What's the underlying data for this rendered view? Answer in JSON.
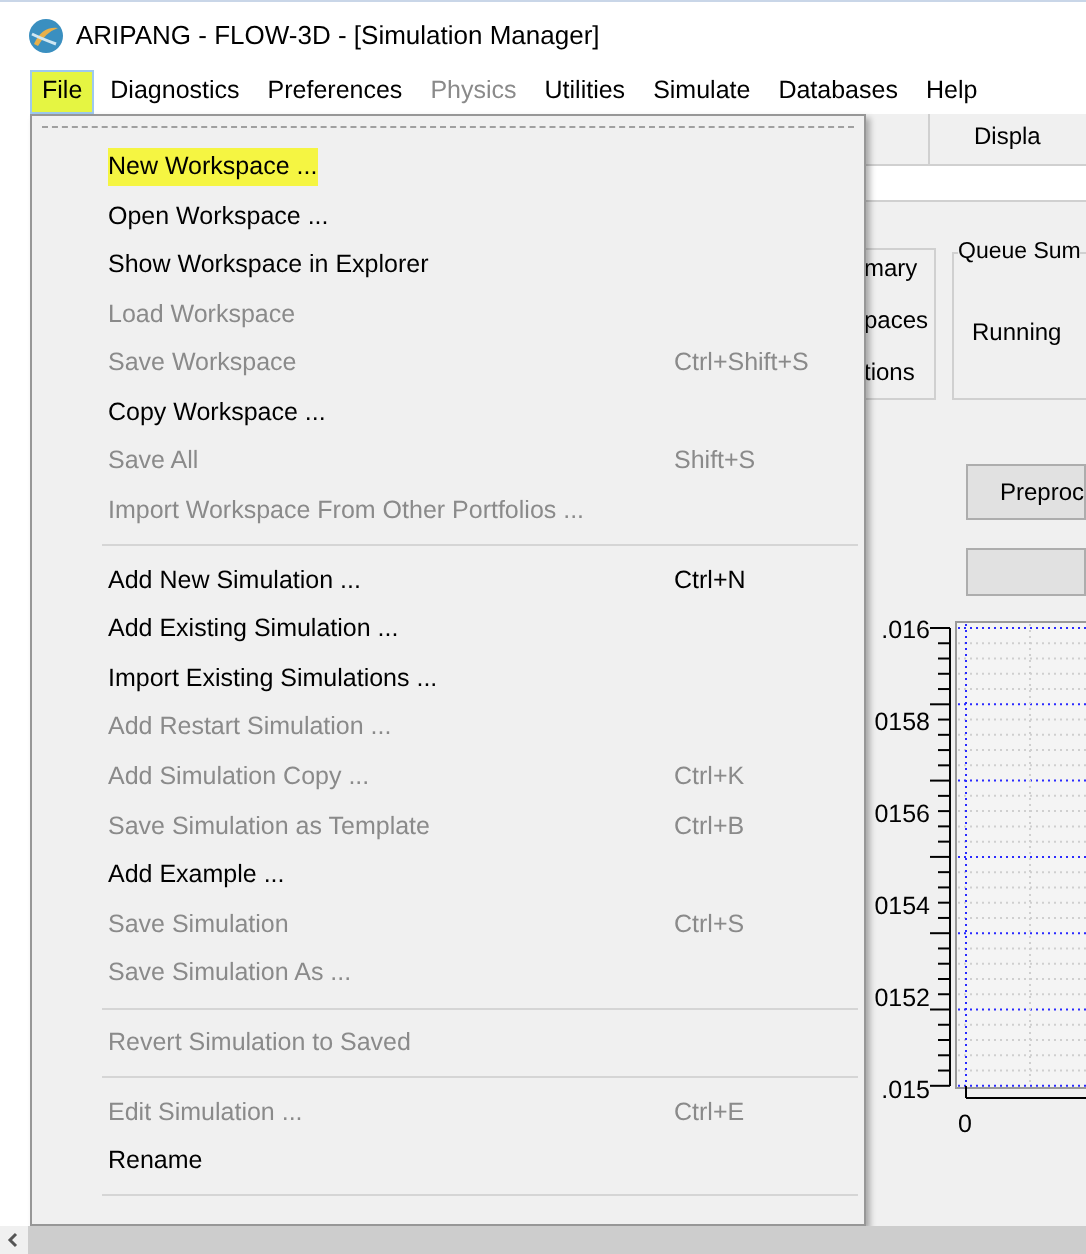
{
  "window": {
    "title": "ARIPANG - FLOW-3D - [Simulation Manager]"
  },
  "menu_bar": [
    {
      "label": "File",
      "selected": true,
      "disabled": false
    },
    {
      "label": "Diagnostics",
      "selected": false,
      "disabled": false
    },
    {
      "label": "Preferences",
      "selected": false,
      "disabled": false
    },
    {
      "label": "Physics",
      "selected": false,
      "disabled": true
    },
    {
      "label": "Utilities",
      "selected": false,
      "disabled": false
    },
    {
      "label": "Simulate",
      "selected": false,
      "disabled": false
    },
    {
      "label": "Databases",
      "selected": false,
      "disabled": false
    },
    {
      "label": "Help",
      "selected": false,
      "disabled": false
    }
  ],
  "file_menu": [
    {
      "kind": "item",
      "label": "New Workspace ...",
      "disabled": false,
      "selected": true
    },
    {
      "kind": "item",
      "label": "Open Workspace ...",
      "disabled": false,
      "selected": false
    },
    {
      "kind": "item",
      "label": "Show Workspace in Explorer",
      "disabled": false,
      "selected": false
    },
    {
      "kind": "item",
      "label": "Load Workspace",
      "disabled": true,
      "selected": false
    },
    {
      "kind": "item",
      "label": "Save Workspace",
      "shortcut": "Ctrl+Shift+S",
      "disabled": true,
      "selected": false
    },
    {
      "kind": "item",
      "label": "Copy Workspace ...",
      "disabled": false,
      "selected": false
    },
    {
      "kind": "item",
      "label": "Save All",
      "shortcut": "Shift+S",
      "disabled": true,
      "selected": false
    },
    {
      "kind": "item",
      "label": "Import Workspace From Other Portfolios ...",
      "disabled": true,
      "selected": false
    },
    {
      "kind": "separator"
    },
    {
      "kind": "item",
      "label": "Add New Simulation ...",
      "shortcut": "Ctrl+N",
      "disabled": false,
      "selected": false
    },
    {
      "kind": "item",
      "label": "Add Existing Simulation ...",
      "disabled": false,
      "selected": false
    },
    {
      "kind": "item",
      "label": "Import Existing Simulations ...",
      "disabled": false,
      "selected": false
    },
    {
      "kind": "item",
      "label": "Add Restart Simulation ...",
      "disabled": true,
      "selected": false
    },
    {
      "kind": "item",
      "label": "Add Simulation Copy ...",
      "shortcut": "Ctrl+K",
      "disabled": true,
      "selected": false
    },
    {
      "kind": "item",
      "label": "Save Simulation as Template",
      "shortcut": "Ctrl+B",
      "disabled": true,
      "selected": false
    },
    {
      "kind": "item",
      "label": "Add Example ...",
      "disabled": false,
      "selected": false
    },
    {
      "kind": "item",
      "label": "Save Simulation",
      "shortcut": "Ctrl+S",
      "disabled": true,
      "selected": false
    },
    {
      "kind": "item",
      "label": "Save Simulation As ...",
      "disabled": true,
      "selected": false
    },
    {
      "kind": "separator"
    },
    {
      "kind": "item",
      "label": "Revert Simulation to Saved",
      "disabled": true,
      "selected": false
    },
    {
      "kind": "separator"
    },
    {
      "kind": "item",
      "label": "Edit Simulation ...",
      "shortcut": "Ctrl+E",
      "disabled": true,
      "selected": false
    },
    {
      "kind": "item",
      "label": "Rename",
      "disabled": false,
      "selected": false
    },
    {
      "kind": "separator"
    }
  ],
  "background": {
    "tab": "Displa",
    "summary_box": [
      "mary",
      "paces",
      "tions"
    ],
    "queue_box": {
      "title": "Queue Sum",
      "label": "Running"
    },
    "preprocess_button": "Preproc",
    "chart": {
      "y_tick_labels": [
        ".016",
        "0158",
        "0156",
        "0154",
        "0152",
        ".015"
      ],
      "x_tick_labels": [
        "0"
      ]
    }
  }
}
